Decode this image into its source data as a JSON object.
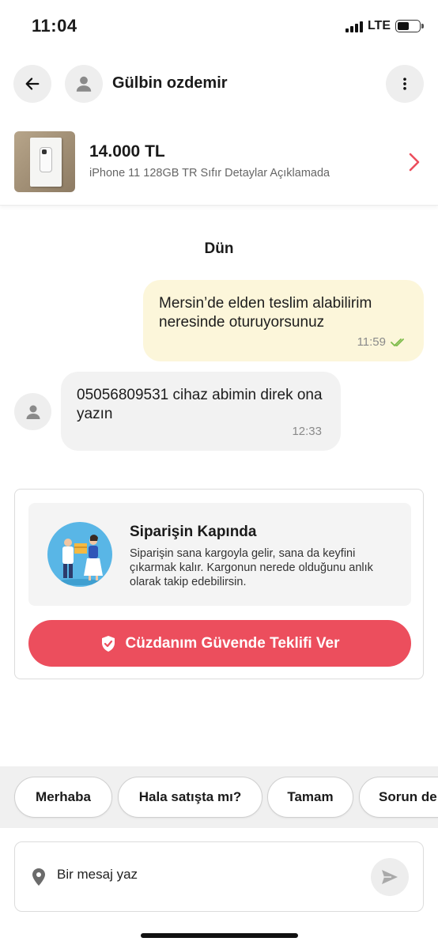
{
  "status_bar": {
    "time": "11:04",
    "network": "LTE"
  },
  "header": {
    "contact_name": "Gülbin ozdemir"
  },
  "product": {
    "price": "14.000 TL",
    "title": "iPhone 11 128GB TR Sıfır Detaylar Açıklamada"
  },
  "chat": {
    "date_separator": "Dün",
    "messages": [
      {
        "direction": "outgoing",
        "text": "Mersin’de elden teslim alabilirim neresinde oturuyorsunuz",
        "time": "11:59",
        "status": "read"
      },
      {
        "direction": "incoming",
        "text": "05056809531 cihaz abimin direk ona yazın",
        "time": "12:33"
      }
    ]
  },
  "order_card": {
    "title": "Siparişin Kapında",
    "description": "Siparişin sana kargoyla gelir, sana da keyfini çıkarmak kalır. Kargonun nerede olduğunu anlık olarak takip edebilirsin.",
    "button_label": "Cüzdanım Güvende Teklifi Ver"
  },
  "quick_replies": [
    "Merhaba",
    "Hala satışta mı?",
    "Tamam",
    "Sorun de"
  ],
  "composer": {
    "placeholder": "Bir mesaj yaz"
  },
  "colors": {
    "accent": "#ec4e5d",
    "outgoing_bubble": "#fcf6da",
    "incoming_bubble": "#f2f2f2",
    "read_check": "#7dbb4a"
  },
  "icons": {
    "back": "arrow-left-icon",
    "avatar": "user-icon",
    "more": "more-vertical-icon",
    "product_nav": "chevron-right-icon",
    "read_status": "double-check-icon",
    "shield": "shield-check-icon",
    "location": "location-pin-icon",
    "send": "send-icon"
  }
}
